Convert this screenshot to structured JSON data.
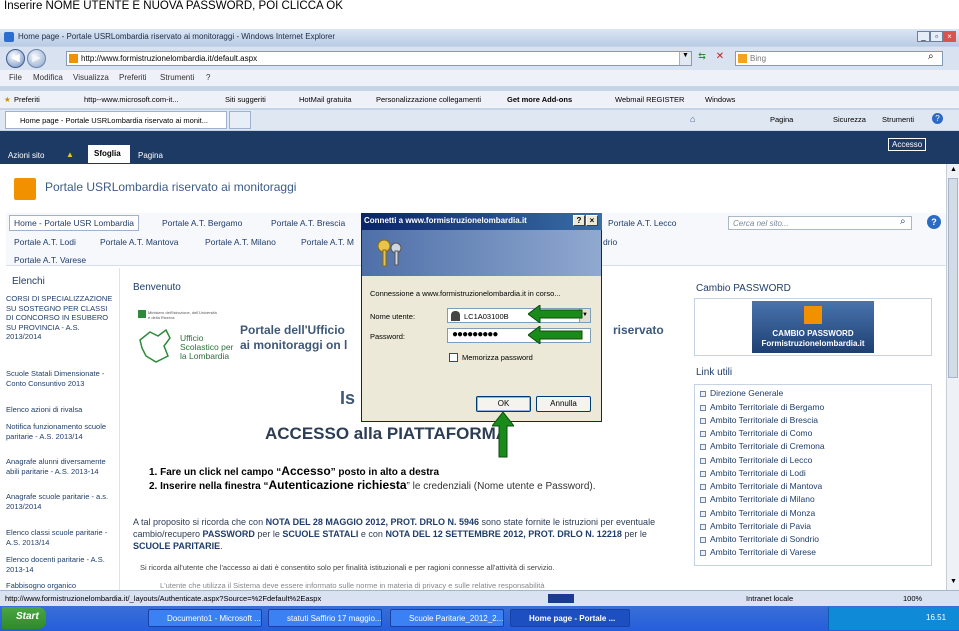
{
  "caption": "Inserire NOME UTENTE E NUOVA PASSWORD, POI CLICCA OK",
  "browser": {
    "title": "Home page - Portale USRLombardia riservato ai monitoraggi - Windows Internet Explorer",
    "url": "http://www.formistruzionelombardia.it/default.aspx",
    "search_placeholder": "Bing",
    "menu": [
      "File",
      "Modifica",
      "Visualizza",
      "Preferiti",
      "Strumenti",
      "?"
    ],
    "favorites": [
      "Preferiti",
      "http--www.microsoft.com-it...",
      "Siti suggeriti",
      "HotMail gratuita",
      "Personalizzazione collegamenti",
      "Get more Add-ons",
      "Webmail REGISTER",
      "Windows"
    ],
    "tab": "Home page - Portale USRLombardia riservato ai monit...",
    "cmd": [
      "Pagina",
      "Sicurezza",
      "Strumenti"
    ],
    "status_url": "http://www.formistruzionelombardia.it/_layouts/Authenticate.aspx?Source=%2Fdefault%2Easpx",
    "zone": "Intranet locale",
    "zoom": "100%"
  },
  "ribbon": {
    "azioni": "Azioni sito",
    "sfoglia": "Sfoglia",
    "pagina": "Pagina",
    "accesso": "Accesso"
  },
  "portal": {
    "title": "Portale USRLombardia riservato ai monitoraggi",
    "nav": [
      "Home - Portale USR Lombardia",
      "Portale A.T. Bergamo",
      "Portale A.T. Brescia",
      "Portale A.T. Lecco",
      "Portale A.T. Lodi",
      "Portale A.T. Mantova",
      "Portale A.T. Milano",
      "Portale A.T. M",
      "drio",
      "Portale A.T. Varese"
    ],
    "search_placeholder": "Cerca nel sito..."
  },
  "left": {
    "heading": "Elenchi",
    "items": [
      "CORSI DI SPECIALIZZAZIONE SU SOSTEGNO PER CLASSI DI CONCORSO IN ESUBERO SU PROVINCIA - A.S. 2013/2014",
      "Scuole Statali Dimensionate - Conto Consuntivo 2013",
      "Elenco azioni di rivalsa",
      "Notifica funzionamento scuole paritarie - A.S. 2013/14",
      "Anagrafe alunni diversamente abili paritarie - A.S. 2013-14",
      "Anagrafe scuole paritarie - a.s. 2013/2014",
      "Elenco classi scuole paritarie - A.S. 2013/14",
      "Elenco docenti paritarie - A.S. 2013-14",
      "Fabbisogno organico"
    ]
  },
  "main": {
    "benvenuto": "Benvenuto",
    "logo_text": "Ufficio Scolastico per la Lombardia",
    "logo_small": "Ministero dell'Istruzione, dell'Università e della Ricerca",
    "portal_line1": "Portale dell'Ufficio",
    "portal_line2": "ai monitoraggi on l",
    "riservato": "riservato",
    "is": "Is",
    "accesso_title": "ACCESSO alla PIATTAFORMA",
    "step1_pre": "1.  Fare un click nel campo “",
    "step1_bold": "Accesso",
    "step1_post": "” posto in alto a destra",
    "step2_pre": "2.  Inserire nella finestra “",
    "step2_bold": "Autenticazione richiesta",
    "step2_post": "” le credenziali (Nome utente e Password).",
    "para1": "A tal proposito si ricorda che con ",
    "para_b1": "NOTA DEL 28 MAGGIO 2012, PROT. DRLO N. 5946",
    "para2": " sono state fornite le istruzioni per eventuale cambio/recupero ",
    "para_b2": "PASSWORD",
    "para3": " per le ",
    "para_b3": "SCUOLE STATALI",
    "para4": " e con ",
    "para_b4": "NOTA DEL 12 SETTEMBRE 2012, PROT. DRLO N. 12218",
    "para5": " per le ",
    "para_b5": "SCUOLE PARITARIE",
    "para6": ".",
    "small1": "Si ricorda all'utente che l'accesso ai dati è consentito solo per finalità istituzionali e per ragioni connesse all'attività di servizio.",
    "small2": "L'utente che utilizza il Sistema deve essere informato sulle norme in materia di privacy e sulle relative responsabilità"
  },
  "right": {
    "cambio_heading": "Cambio PASSWORD",
    "cambio_btn1": "CAMBIO PASSWORD",
    "cambio_btn2": "Formistruzionelombardia.it",
    "link_heading": "Link utili",
    "links": [
      "Direzione Generale",
      "Ambito Territoriale di Bergamo",
      "Ambito Territoriale di Brescia",
      "Ambito Territoriale di Como",
      "Ambito Territoriale di Cremona",
      "Ambito Territoriale di Lecco",
      "Ambito Territoriale di Lodi",
      "Ambito Territoriale di Mantova",
      "Ambito Territoriale di Milano",
      "Ambito Territoriale di Monza",
      "Ambito Territoriale di Pavia",
      "Ambito Territoriale di Sondrio",
      "Ambito Territoriale di Varese"
    ]
  },
  "dialog": {
    "title": "Connetti a www.formistruzionelombardia.it",
    "connecting": "Connessione a www.formistruzionelombardia.it in corso...",
    "user_label": "Nome utente:",
    "user_value": "LC1A03100B",
    "pwd_label": "Password:",
    "pwd_value": "●●●●●●●●●",
    "remember": "Memorizza password",
    "ok": "OK",
    "cancel": "Annulla"
  },
  "taskbar": {
    "start": "Start",
    "items": [
      "Documento1 - Microsoft ...",
      "statuti Saffirio 17 maggio...",
      "Scuole Paritarie_2012_2...",
      "Home page - Portale ..."
    ],
    "clock": "16.51"
  },
  "colors": {
    "arrow": "#1a8a1a",
    "ribbon": "#1c3a63",
    "link": "#1f3d6b"
  }
}
